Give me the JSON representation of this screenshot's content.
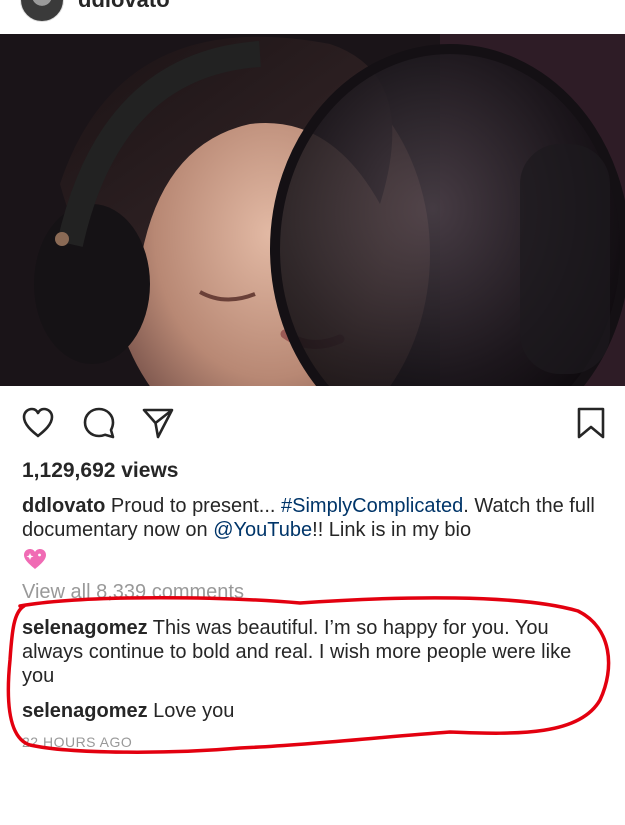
{
  "post": {
    "username": "ddlovato",
    "views": "1,129,692 views",
    "caption": {
      "author": "ddlovato",
      "text_1": " Proud to present... ",
      "hashtag": "#SimplyComplicated",
      "text_2": ". Watch the full documentary now on ",
      "mention": "@YouTube",
      "text_3": "!! Link is in my bio"
    },
    "view_all_comments": "View all 8,339 comments",
    "comments": [
      {
        "author": "selenagomez",
        "text": " This was beautiful. I’m so happy for you. You always continue to bold and real. I wish more people were like you"
      },
      {
        "author": "selenagomez",
        "text": " Love you"
      }
    ],
    "time_ago": "22 HOURS AGO"
  },
  "icons": {
    "like": "heart-outline-icon",
    "comment": "comment-bubble-icon",
    "share": "send-paper-plane-icon",
    "save": "bookmark-icon",
    "caption_emoji": "sparkling-pink-heart-icon"
  },
  "colors": {
    "text": "#262626",
    "link": "#003569",
    "muted": "#999999",
    "annotation": "#e3000f",
    "heart_emoji": "#f06bb4"
  }
}
